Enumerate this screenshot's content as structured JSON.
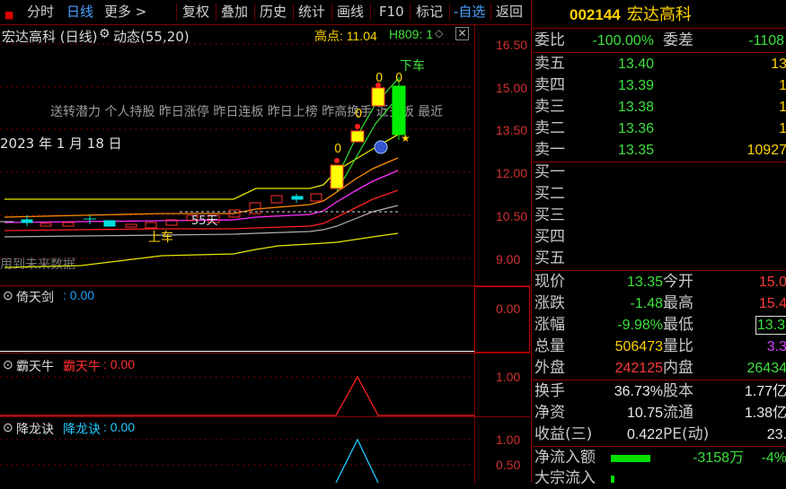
{
  "toolbar": {
    "items": [
      "分时",
      "日线",
      "更多 >",
      "复权",
      "叠加",
      "历史",
      "统计",
      "画线",
      "F10",
      "标记",
      "-自选",
      "返回"
    ]
  },
  "chart": {
    "title": "宏达高科 (日线)",
    "indicator_name": "动态(55,20)",
    "high_label": "高点: 11.04",
    "h_label": "H809: 1",
    "date_label": "2023 年 1 月 18 日",
    "scroll_text": "送转潜力 个人持股 昨日涨停 昨日连板 昨日上榜 昨高换手 近多板 最近",
    "future_text": "用到未来数据",
    "sell_signal": "下车",
    "buy_signal": "上车",
    "day_marker": "55天",
    "zero_marks": [
      "0",
      "0",
      "0",
      "0"
    ],
    "price_ticks": [
      "16.50",
      "15.00",
      "13.50",
      "12.00",
      "10.50",
      "9.00"
    ]
  },
  "panes": {
    "p1": {
      "name": "倚天剑",
      "value": ": 0.00",
      "ticks": [
        "0.00"
      ]
    },
    "p2": {
      "name": "霸天牛",
      "sub_name": "霸天牛",
      "value": ": 0.00",
      "ticks": [
        "1.00"
      ]
    },
    "p3": {
      "name": "降龙诀",
      "sub_name": "降龙诀",
      "value": ": 0.00",
      "ticks": [
        "1.00",
        "0.50"
      ]
    }
  },
  "quote": {
    "code": "002144",
    "name": "宏达高科",
    "weibi_label": "委比",
    "weibi_value": "-100.00%",
    "weicha_label": "委差",
    "weicha_value": "-1108",
    "sells": [
      {
        "label": "卖五",
        "price": "13.40",
        "vol": "13"
      },
      {
        "label": "卖四",
        "price": "13.39",
        "vol": "1"
      },
      {
        "label": "卖三",
        "price": "13.38",
        "vol": "1"
      },
      {
        "label": "卖二",
        "price": "13.36",
        "vol": "1"
      },
      {
        "label": "卖一",
        "price": "13.35",
        "vol": "10927"
      }
    ],
    "buys": [
      "买一",
      "买二",
      "买三",
      "买四",
      "买五"
    ],
    "stats": [
      {
        "l1": "现价",
        "v1": "13.35",
        "c1": "green",
        "l2": "今开",
        "v2": "15.0",
        "c2": "red"
      },
      {
        "l1": "涨跌",
        "v1": "-1.48",
        "c1": "green",
        "l2": "最高",
        "v2": "15.4",
        "c2": "red"
      },
      {
        "l1": "涨幅",
        "v1": "-9.98%",
        "c1": "green",
        "l2": "最低",
        "v2": "13.3",
        "c2": "green"
      },
      {
        "l1": "总量",
        "v1": "506473",
        "c1": "yellow",
        "l2": "量比",
        "v2": "3.3",
        "c2": "purple"
      },
      {
        "l1": "外盘",
        "v1": "242125",
        "c1": "red",
        "l2": "内盘",
        "v2": "26434",
        "c2": "green"
      }
    ],
    "stats2": [
      {
        "l1": "换手",
        "v1": "36.73%",
        "l2": "股本",
        "v2": "1.77亿"
      },
      {
        "l1": "净资",
        "v1": "10.75",
        "l2": "流通",
        "v2": "1.38亿"
      },
      {
        "l1": "收益(三)",
        "v1": "0.422",
        "l2": "PE(动)",
        "v2": "23."
      }
    ],
    "netflow_label": "净流入额",
    "netflow_value": "-3158万",
    "netflow_pct": "-4%",
    "bigflow_label": "大宗流入"
  }
}
